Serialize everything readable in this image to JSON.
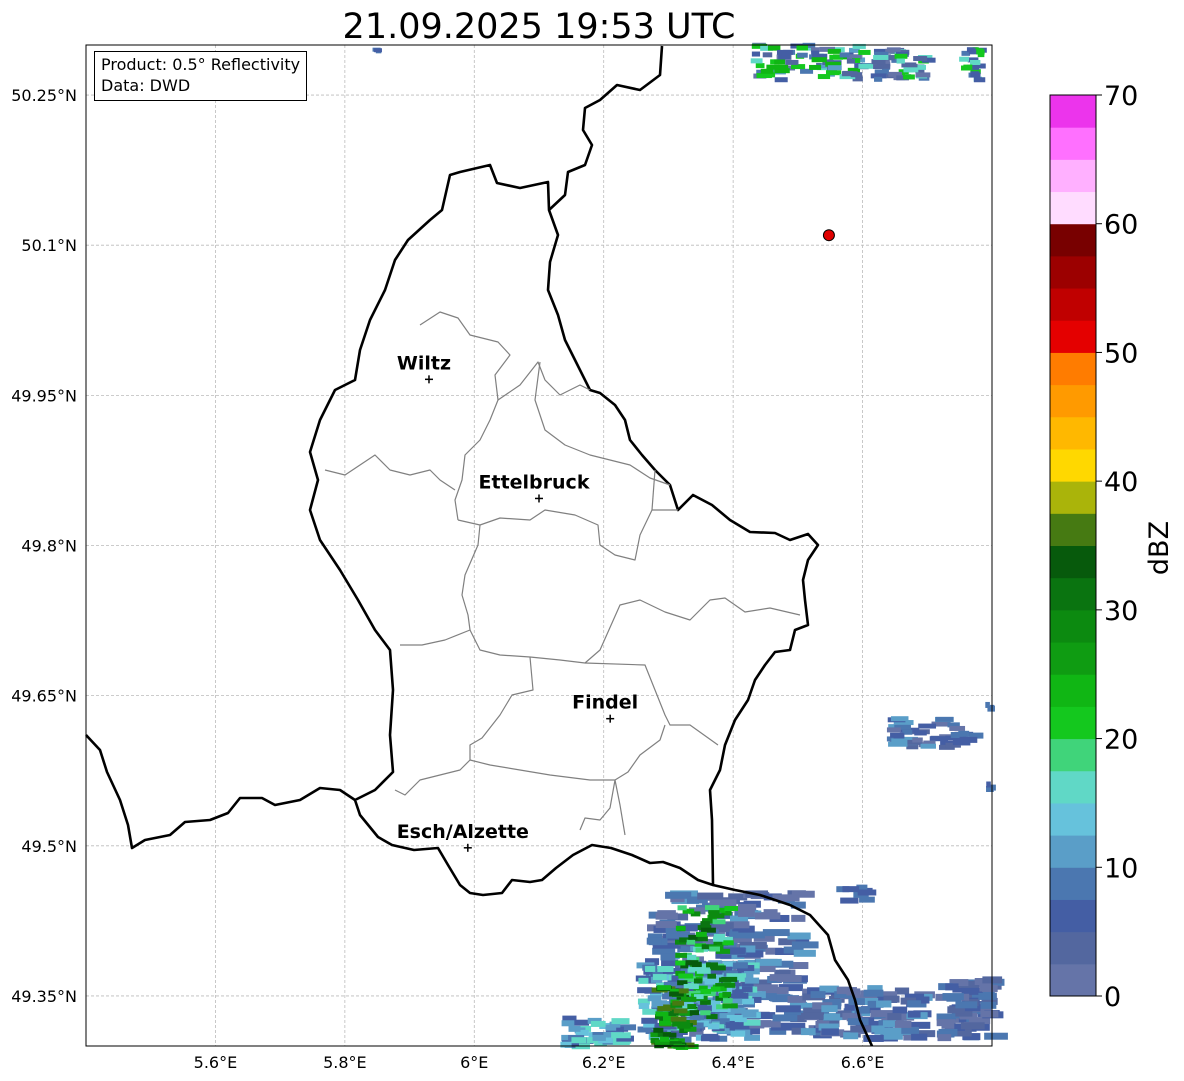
{
  "title": "21.09.2025 19:53 UTC",
  "info": {
    "product": "Product: 0.5° Reflectivity",
    "data_source": "Data: DWD"
  },
  "lat_ticks": [
    "50.25°N",
    "50.1°N",
    "49.95°N",
    "49.8°N",
    "49.65°N",
    "49.5°N",
    "49.35°N"
  ],
  "lon_ticks": [
    "5.6°E",
    "5.8°E",
    "6°E",
    "6.2°E",
    "6.4°E",
    "6.6°E"
  ],
  "cities": [
    {
      "name": "Wiltz",
      "lon": 5.93,
      "lat": 49.966
    },
    {
      "name": "Ettelbruck",
      "lon": 6.1,
      "lat": 49.847
    },
    {
      "name": "Findel",
      "lon": 6.21,
      "lat": 49.627
    },
    {
      "name": "Esch/Alzette",
      "lon": 5.99,
      "lat": 49.498
    }
  ],
  "radar_site": {
    "lon": 6.548,
    "lat": 50.11,
    "color": "#e00000"
  },
  "colorbar": {
    "label": "dBZ",
    "ticks": [
      "0",
      "10",
      "20",
      "30",
      "40",
      "50",
      "60",
      "70"
    ],
    "min": 0,
    "max": 70,
    "step": 2.5,
    "colors": [
      "#6574a8",
      "#53679f",
      "#445ea4",
      "#4b77b0",
      "#5a9ec8",
      "#66c2dc",
      "#60d8c6",
      "#40d47a",
      "#14c81e",
      "#10b614",
      "#0f9c12",
      "#0c8a10",
      "#0a7410",
      "#075a0c",
      "#467a12",
      "#aab40a",
      "#ffd800",
      "#ffb800",
      "#ff9a00",
      "#ff7c00",
      "#e40000",
      "#c00000",
      "#9c0000",
      "#780000",
      "#ffdcff",
      "#ffb0ff",
      "#ff70ff",
      "#ec34ec"
    ]
  },
  "map_extent": {
    "lon_min": 5.4,
    "lon_max": 6.8,
    "lat_min": 49.3,
    "lat_max": 50.3
  }
}
